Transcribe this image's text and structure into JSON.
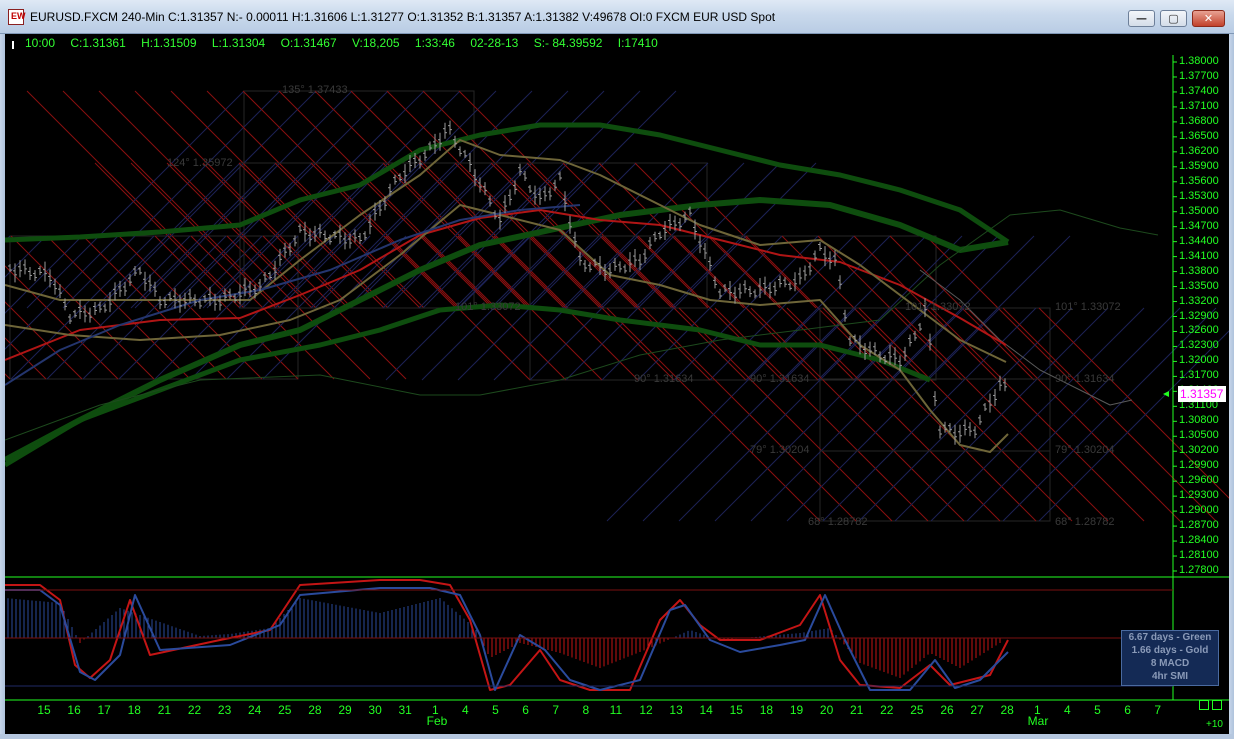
{
  "window": {
    "title": "EURUSD.FXCM 240-Min C:1.31357 N:- 0.00011 H:1.31606 L:1.31277 O:1.31352 B:1.31357 A:1.31382 V:49678 OI:0 FXCM EUR USD Spot",
    "app_icon_text": "EW",
    "minimize_glyph": "—",
    "maximize_glyph": "▢",
    "close_glyph": "✕"
  },
  "infobar": {
    "time": "10:00",
    "close": "C:1.31361",
    "high": "H:1.31509",
    "low": "L:1.31304",
    "open": "O:1.31467",
    "volume": "V:18,205",
    "clock": "1:33:46",
    "date": "02-28-13",
    "s_value": "S:- 84.39592",
    "i_value": "I:17410"
  },
  "price_axis": [
    "1.38000",
    "1.37700",
    "1.37400",
    "1.37100",
    "1.36800",
    "1.36500",
    "1.36200",
    "1.35900",
    "1.35600",
    "1.35300",
    "1.35000",
    "1.34700",
    "1.34400",
    "1.34100",
    "1.33800",
    "1.33500",
    "1.33200",
    "1.32900",
    "1.32600",
    "1.32300",
    "1.32000",
    "1.31700",
    "1.31400",
    "1.31100",
    "1.30800",
    "1.30500",
    "1.30200",
    "1.29900",
    "1.29600",
    "1.29300",
    "1.29000",
    "1.28700",
    "1.28400",
    "1.28100",
    "1.27800"
  ],
  "current_price": "1.31357",
  "date_axis": [
    "15",
    "16",
    "17",
    "18",
    "21",
    "22",
    "23",
    "24",
    "25",
    "28",
    "29",
    "30",
    "31",
    "1",
    "4",
    "5",
    "6",
    "7",
    "8",
    "11",
    "12",
    "13",
    "14",
    "15",
    "18",
    "19",
    "20",
    "21",
    "22",
    "25",
    "26",
    "27",
    "28",
    "1",
    "4",
    "5",
    "6",
    "7"
  ],
  "month_labels": {
    "feb": "Feb",
    "mar": "Mar"
  },
  "gann_labels": {
    "l135": "135°  1.37433",
    "l124": "124°  1.35972",
    "l101a": "101°  1.33072",
    "l101b": "101°  1.33072",
    "l101c": "101°  1.33072",
    "l90a": "90°  1.31634",
    "l90b": "90°  1.31634",
    "l90c": "90°  1.31634",
    "l79a": "79°  1.30204",
    "l79b": "79°  1.30204",
    "l68a": "68°  1.28782",
    "l68b": "68°  1.28782"
  },
  "legend": {
    "line1": "6.67 days - Green",
    "line2": "1.66 days - Gold",
    "line3": "8 MACD",
    "line4": "4hr SMI"
  },
  "zoom": "+10",
  "colors": {
    "axis": "#22ff22",
    "bars": "#9a9a9a",
    "ma_red": "#b01515",
    "ma_green": "#0e4d0e",
    "envelope_gold": "#6e6538",
    "ma_blue": "#24356e",
    "gann_red": "#8a1010",
    "gann_blue": "#1c2255",
    "osc_red": "#c41515",
    "osc_blue": "#2a4a9c"
  }
}
